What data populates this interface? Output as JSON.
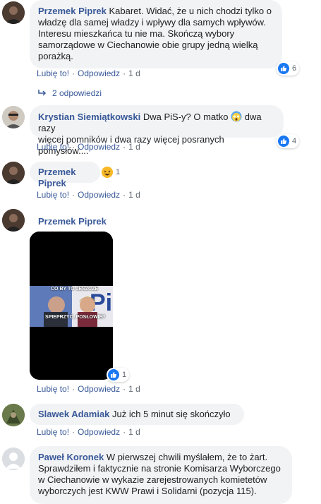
{
  "comments": [
    {
      "author": "Przemek Piprek",
      "lines": [
        "Kabaret. Widać, że u nich chodzi tylko o",
        "władzę dla samej władzy i wpływy dla samych wpływów.",
        "Interesu mieszkańca tu nie ma. Skończą wybory",
        "samorządowe w Ciechanowie obie grupy jedną wielką",
        "porażką."
      ],
      "reaction_count": "6",
      "like_label": "Lubię to!",
      "reply_label": "Odpowiedz",
      "time": "1 d",
      "replies_label": "2 odpowiedzi"
    },
    {
      "author": "Krystian Siemiątkowski",
      "line1_before": "Dwa PiS-y? O matko",
      "line1_after": "dwa razy",
      "line2": "więcej pomników i dwa razy więcej posranych pomysłów....",
      "reaction_count": "4",
      "like_label": "Lubię to!",
      "reply_label": "Odpowiedz",
      "time": "1 d"
    },
    {
      "author": "Przemek Piprek",
      "reaction_count": "1",
      "like_label": "Lubię to!",
      "reply_label": "Odpowiedz",
      "time": "1 d"
    },
    {
      "author": "Przemek Piprek",
      "meme_top": "CO BY TO JESZCZE",
      "meme_bottom": "SPIEPRZYĆ, POSŁOWIE?",
      "reaction_count": "1",
      "like_label": "Lubię to!",
      "reply_label": "Odpowiedz",
      "time": "1 d"
    },
    {
      "author": "Slawek Adamiak",
      "text": "Już ich 5 minut się skończyło",
      "like_label": "Lubię to!",
      "reply_label": "Odpowiedz",
      "time": "1 d"
    },
    {
      "author": "Paweł Koronek",
      "lines": [
        "W pierwszej chwili myślałem, że to żart.",
        "Sprawdziłem i faktycznie na stronie Komisarza Wyborczego",
        "w Ciechanowie w wykazie zarejestrowanych komietetów",
        "wyborczych jest KWW Prawi i Solidarni (pozycja 115)."
      ]
    }
  ],
  "sep": "·",
  "colors": {
    "link": "#385898",
    "bubble": "#f2f3f5",
    "like": "#1877f2",
    "meta": "#606770"
  },
  "icons": [
    "like-icon",
    "reply-arrow-icon",
    "shocked-emoji-icon",
    "laughing-emoji-icon",
    "default-avatar-icon"
  ]
}
